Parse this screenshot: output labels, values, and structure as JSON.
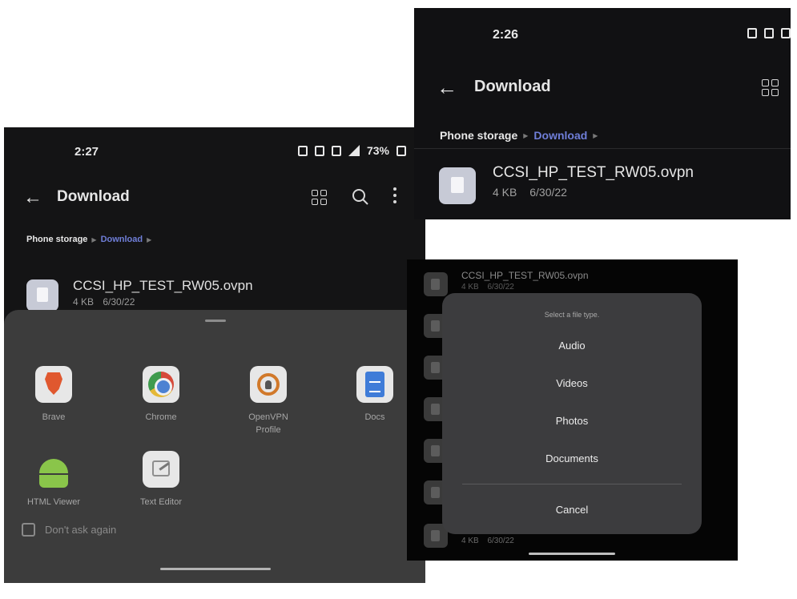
{
  "left": {
    "time": "2:27",
    "battery": "73%",
    "title": "Download",
    "breadcrumb": [
      "Phone storage",
      "Download"
    ],
    "file": {
      "name": "CCSI_HP_TEST_RW05.ovpn",
      "size": "4 KB",
      "date": "6/30/22"
    },
    "apps": [
      {
        "label": "Brave",
        "icon": "brave-icon"
      },
      {
        "label": "Chrome",
        "icon": "chrome-icon"
      },
      {
        "label": "OpenVPN Profile",
        "icon": "openvpn-icon"
      },
      {
        "label": "Docs",
        "icon": "docs-icon"
      },
      {
        "label": "HTML Viewer",
        "icon": "android-icon"
      },
      {
        "label": "Text Editor",
        "icon": "text-editor-icon"
      }
    ],
    "dont_ask": "Don't ask again"
  },
  "top_right": {
    "time": "2:26",
    "title": "Download",
    "breadcrumb": [
      "Phone storage",
      "Download"
    ],
    "file": {
      "name": "CCSI_HP_TEST_RW05.ovpn",
      "size": "4 KB",
      "date": "6/30/22"
    }
  },
  "bottom_right": {
    "file": {
      "name": "CCSI_HP_TEST_RW05.ovpn",
      "size": "4 KB",
      "date": "6/30/22"
    },
    "dialog": {
      "title": "Select a file type.",
      "options": [
        "Audio",
        "Videos",
        "Photos",
        "Documents"
      ],
      "cancel": "Cancel"
    }
  },
  "colors": {
    "accent": "#6f7ed8",
    "background": "#141415",
    "sheet": "#3c3c3c"
  }
}
